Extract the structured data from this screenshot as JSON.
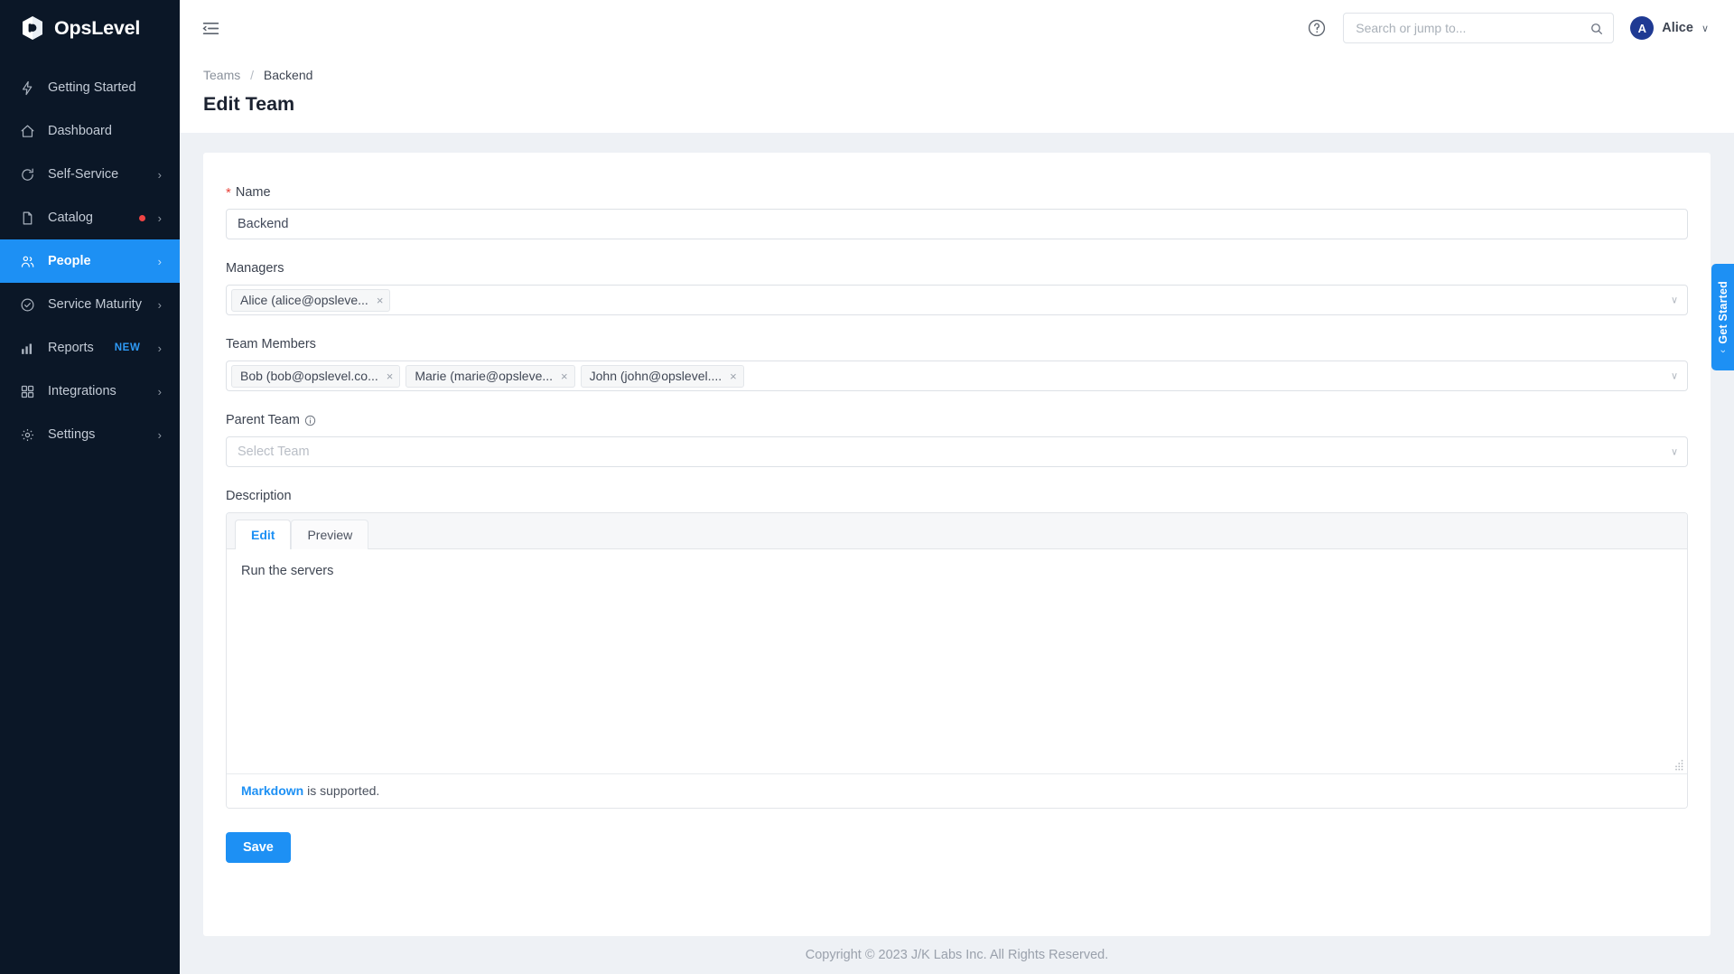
{
  "brand": {
    "name": "OpsLevel",
    "logo_icon": "opslevel-hex-logo"
  },
  "sidebar": {
    "items": [
      {
        "label": "Getting Started",
        "icon": "lightning-bolt-icon",
        "chevron": false,
        "active": false
      },
      {
        "label": "Dashboard",
        "icon": "home-icon",
        "chevron": false,
        "active": false
      },
      {
        "label": "Self-Service",
        "icon": "refresh-circle-icon",
        "chevron": true,
        "active": false
      },
      {
        "label": "Catalog",
        "icon": "document-icon",
        "chevron": true,
        "active": false,
        "dot": true
      },
      {
        "label": "People",
        "icon": "people-icon",
        "chevron": true,
        "active": true
      },
      {
        "label": "Service Maturity",
        "icon": "check-circle-icon",
        "chevron": true,
        "active": false
      },
      {
        "label": "Reports",
        "icon": "bar-chart-icon",
        "chevron": true,
        "active": false,
        "badge": "NEW"
      },
      {
        "label": "Integrations",
        "icon": "grid-squares-icon",
        "chevron": true,
        "active": false
      },
      {
        "label": "Settings",
        "icon": "gear-icon",
        "chevron": true,
        "active": false
      }
    ]
  },
  "topbar": {
    "menu_toggle_icon": "menu-collapse-icon",
    "help_icon": "question-circle-icon",
    "search": {
      "placeholder": "Search or jump to...",
      "value": "",
      "icon": "search-icon"
    },
    "user": {
      "initial": "A",
      "name": "Alice",
      "caret": "∨"
    }
  },
  "breadcrumb": {
    "parent": "Teams",
    "separator": "/",
    "current": "Backend"
  },
  "page": {
    "title": "Edit Team"
  },
  "form": {
    "name": {
      "label": "Name",
      "required_marker": "*",
      "value": "Backend",
      "placeholder": ""
    },
    "managers": {
      "label": "Managers",
      "tags": [
        "Alice (alice@opsleve..."
      ],
      "remove_icon": "×",
      "caret": "∨"
    },
    "team_members": {
      "label": "Team Members",
      "tags": [
        "Bob (bob@opslevel.co...",
        "Marie (marie@opsleve...",
        "John (john@opslevel...."
      ],
      "remove_icon": "×",
      "caret": "∨"
    },
    "parent_team": {
      "label": "Parent Team",
      "info_icon": "info-circle-icon",
      "placeholder": "Select Team",
      "value": "",
      "caret": "∨"
    },
    "description": {
      "label": "Description",
      "tabs": [
        {
          "label": "Edit",
          "active": true
        },
        {
          "label": "Preview",
          "active": false
        }
      ],
      "value": "Run the servers",
      "footer_link": "Markdown",
      "footer_text": " is supported."
    },
    "save_label": "Save"
  },
  "get_started": {
    "label": "Get Started",
    "chevron": "‹"
  },
  "footer": {
    "copyright": "Copyright © 2023 J/K Labs Inc. All Rights Reserved."
  },
  "colors": {
    "sidebar_bg": "#0b1727",
    "accent": "#1d90f4",
    "required": "#e8453c",
    "badge_dot": "#ef4444",
    "avatar_bg": "#1f3a93",
    "page_bg": "#eef1f5"
  }
}
